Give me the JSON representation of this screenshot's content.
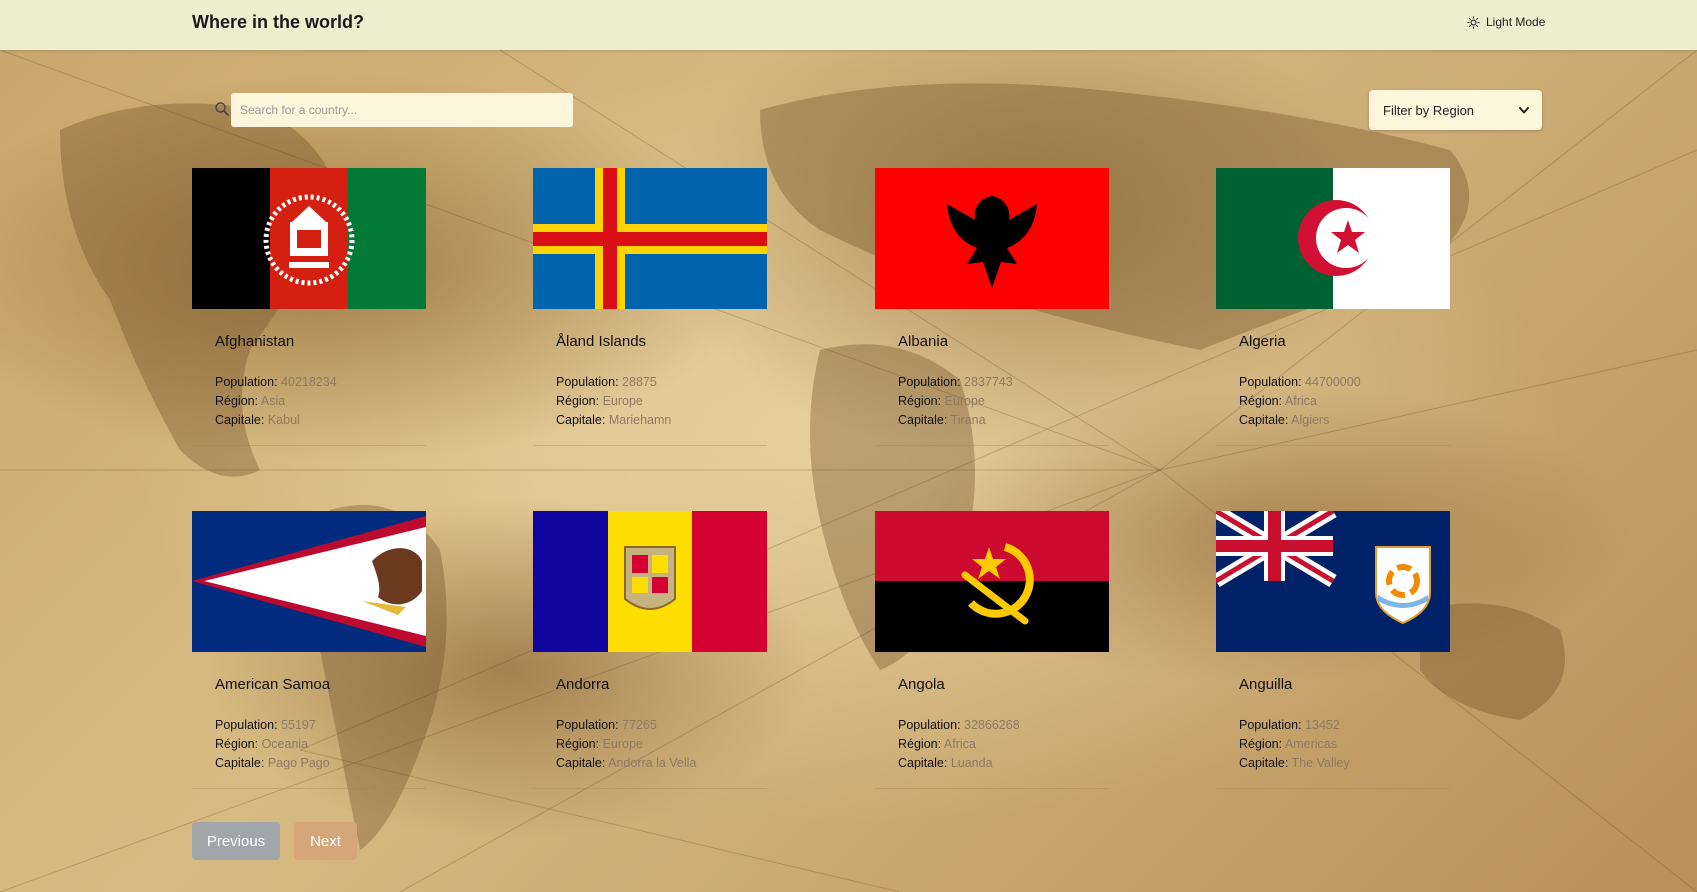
{
  "header": {
    "title": "Where in the world?",
    "mode_label": "Light Mode",
    "mode_icon": "sun-icon"
  },
  "search": {
    "placeholder": "Search for a country...",
    "value": "",
    "icon": "search-icon"
  },
  "filter": {
    "selected": "Filter by Region",
    "icon": "chevron-down-icon"
  },
  "labels": {
    "population": "Population:",
    "region": "Région:",
    "capital": "Capitale:"
  },
  "countries": [
    {
      "name": "Afghanistan",
      "population": "40218234",
      "region": "Asia",
      "capital": "Kabul"
    },
    {
      "name": "Åland Islands",
      "population": "28875",
      "region": "Europe",
      "capital": "Mariehamn"
    },
    {
      "name": "Albania",
      "population": "2837743",
      "region": "Europe",
      "capital": "Tirana"
    },
    {
      "name": "Algeria",
      "population": "44700000",
      "region": "Africa",
      "capital": "Algiers"
    },
    {
      "name": "American Samoa",
      "population": "55197",
      "region": "Oceania",
      "capital": "Pago Pago"
    },
    {
      "name": "Andorra",
      "population": "77265",
      "region": "Europe",
      "capital": "Andorra la Vella"
    },
    {
      "name": "Angola",
      "population": "32866268",
      "region": "Africa",
      "capital": "Luanda"
    },
    {
      "name": "Anguilla",
      "population": "13452",
      "region": "Americas",
      "capital": "The Valley"
    }
  ],
  "pagination": {
    "previous_label": "Previous",
    "next_label": "Next"
  },
  "colors": {
    "header_bg": "#ecefcf",
    "previous_button": "#a0a6aa",
    "next_button": "#d4a67a",
    "value_text": "#8f7a60"
  }
}
